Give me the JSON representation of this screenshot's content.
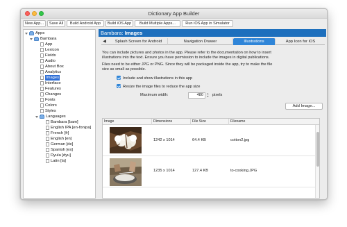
{
  "window": {
    "title": "Dictionary App Builder"
  },
  "toolbar": {
    "buttons": [
      "New App...",
      "Save All",
      "Build Android App",
      "Build iOS App",
      "Build Multiple Apps...",
      "Run iOS App in Simulator"
    ]
  },
  "tree": {
    "root": "Apps",
    "app": "Bambara",
    "app_items": [
      "App",
      "Lexicon",
      "Fields",
      "Audio",
      "About Box",
      "Analytics",
      "Images",
      "Interface",
      "Features",
      "Changes",
      "Fonts",
      "Colors",
      "Styles"
    ],
    "selected_item": "Images",
    "languages_label": "Languages",
    "languages": [
      "Bambara [bam]",
      "English IPA [en-fonipa]",
      "French [fr]",
      "English [en]",
      "German [de]",
      "Spanish [es]",
      "Dyula [dyu]",
      "Latin [la]"
    ]
  },
  "header": {
    "app_name": "Bambara",
    "separator": ": ",
    "section": "Images"
  },
  "tabs": {
    "arrow": "◀",
    "items": [
      "Splash Screen for Android",
      "Navigation Drawer",
      "Illustrations",
      "App Icon for iOS"
    ],
    "active": "Illustrations"
  },
  "illustrations": {
    "description_lines": [
      "You can include pictures and photos in the app. Please refer to the documentation on how to insert",
      "illustrations into the text. Ensure you have permission to include the images in digital publications."
    ],
    "format_lines": [
      "Files need to be either JPG or PNG. Since they will be packaged inside the app, try to make the file",
      "size as small as possible."
    ],
    "include_checkbox_label": "Include and show illustrations in this app",
    "resize_checkbox_label": "Resize the image files to reduce the app size",
    "max_width_label": "Maximum width:",
    "max_width_value": "480",
    "max_width_unit": "pixels",
    "add_image_button": "Add Image..."
  },
  "images_table": {
    "columns": [
      "Image",
      "Dimensions",
      "File Size",
      "Filename"
    ],
    "rows": [
      {
        "image": "cotton-photo",
        "dimensions": "1242 x 1014",
        "file_size": "64.4 KB",
        "filename": "cotton2.jpg"
      },
      {
        "image": "cooking-photo",
        "dimensions": "1235 x 1014",
        "file_size": "127.4 KB",
        "filename": "to-cooking.JPG"
      }
    ]
  }
}
